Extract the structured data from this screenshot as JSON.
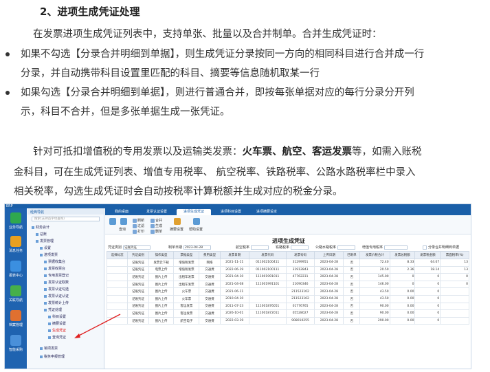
{
  "doc": {
    "heading": "2、进项生成凭证处理",
    "intro": "在发票进项生成凭证列表中，支持单张、批量以及合并制单。合并生成凭证时：",
    "bullet1_line1": "如果不勾选【分录合并明细到单据】，则生成凭证分录按同一方向的相同科目进行合并成一行",
    "bullet1_line2": "分录，并自动携带科目设置里匹配的科目、摘要等信息随机取某一行",
    "bullet2_line1": "如果勾选【分录合并明细到单据】，则进行普通合并，即按每张单据对应的每行分录分开列",
    "bullet2_line2": "示，科目不合并，但是多张单据生成一张凭证。",
    "p2_pre": "针对可抵扣增值税的专用发票以及运输类发票：",
    "p2_bold": "火车票、航空、客运发票",
    "p2_post": "等，如需入账税",
    "p2_line2": "金科目，可在生成凭证列表、增值专用税率、 航空税率、铁路税率、公路水路税率栏中录入",
    "p2_line3": "相关税率，勾选生成凭证时会自动按税率计算税额并生成对应的税金分录。"
  },
  "app": {
    "title": "ERP",
    "nav": [
      {
        "label": "业务导航",
        "color": "#2fa84f"
      },
      {
        "label": "消息任务",
        "color": "#e8a020"
      },
      {
        "label": "报表中心",
        "color": "#3b8fe0"
      },
      {
        "label": "关联导航",
        "color": "#46b04a"
      },
      {
        "label": "档案管理",
        "color": "#e07030"
      },
      {
        "label": "智能采购",
        "color": "#4a90d9"
      }
    ],
    "tree_title": "经典导航",
    "tree_search": "搜索(支持首字母查询)",
    "tree_items": [
      "财务会计",
      "总账",
      "发票管理",
      "设置",
      "进项发票",
      "票据收集台",
      "发票收票台",
      "专用发票登记",
      "发票认证取数",
      "发票认证勾选",
      "发票认证认证",
      "发票统计上传",
      "凭证处理",
      "科目设置",
      "摘要设置",
      "生成凭证",
      "查询凭证",
      "销项发票",
      "税务申报管理"
    ],
    "tabs": [
      "我的桌面",
      "发票认证设置",
      "进项生成凭证",
      "进项科目设置",
      "进项摘要设定"
    ],
    "toolbar": {
      "query": "查询",
      "refresh": "刷新",
      "filter": "过滤",
      "merge": "合并",
      "generate": "生成",
      "print": "打印",
      "delete": "删单",
      "settings": "摘要设置",
      "help": "帮助设置"
    },
    "page_title": "进项生成凭证",
    "filters": {
      "voucher_type_label": "凭证类别",
      "voucher_type_value": "记账凭证",
      "date_label": "制单日期",
      "date_value": "2023-04-28",
      "air_label": "航空税率",
      "rail_label": "铁路税率",
      "road_label": "公路水路税率",
      "vat_label": "增值专用税率",
      "merge_label": "分录合并明细到单据"
    },
    "columns": [
      "选择标志",
      "凭证类别",
      "操作类型",
      "票据类型",
      "费用类型",
      "发票日期",
      "发票代码",
      "发票号码",
      "上传日期",
      "已制单",
      "发票价税合计",
      "发票总税额",
      "发票税金额",
      "票面税率(%)"
    ],
    "rows": [
      [
        "",
        "记账凭证",
        "发票云下载",
        "增值税发票",
        "网络",
        "2021-11-11",
        "011002100411",
        "31299951",
        "2023-04-28",
        "否",
        "72.40",
        "8.33",
        "64.07",
        "13"
      ],
      [
        "",
        "记账凭证",
        "电票上传",
        "增值税发票",
        "交通费",
        "2022-06-19",
        "011002100111",
        "31912843",
        "2023-04-28",
        "否",
        "20.50",
        "2.36",
        "18.14",
        "13"
      ],
      [
        "",
        "记账凭证",
        "图片上传",
        "出租车发票",
        "交通费",
        "2021-04-10",
        "111001991011",
        "47762231",
        "2023-04-28",
        "否",
        "145.00",
        "0",
        "0",
        "0"
      ],
      [
        "",
        "记账凭证",
        "图片上传",
        "出租车发票",
        "交通费",
        "2021-04-08",
        "111001991101",
        "21090346",
        "2023-04-28",
        "否",
        "146.00",
        "0",
        "0",
        "0"
      ],
      [
        "",
        "记账凭证",
        "图片上传",
        "火车票",
        "交通费",
        "2021-06-11",
        "",
        "211523102",
        "2023-04-28",
        "否",
        "43.50",
        "0.00",
        "0",
        ""
      ],
      [
        "",
        "记账凭证",
        "图片上传",
        "火车票",
        "交通费",
        "2010-04-10",
        "",
        "211523102",
        "2023-04-28",
        "否",
        "43.50",
        "0.00",
        "0",
        ""
      ],
      [
        "",
        "记账凭证",
        "图片上传",
        "客运发票",
        "交通费",
        "2011-07-23",
        "111001876051",
        "01776765",
        "2023-04-28",
        "否",
        "90.00",
        "0.00",
        "0",
        ""
      ],
      [
        "",
        "记账凭证",
        "图片上传",
        "客运发票",
        "交通费",
        "2026-10-01",
        "111001872011",
        "05528027",
        "2023-04-28",
        "否",
        "90.00",
        "0.00",
        "0",
        ""
      ],
      [
        "",
        "记账凭证",
        "图片上传",
        "航空电子",
        "交通费",
        "2022-03-19",
        "",
        "908010255",
        "2023-04-28",
        "否",
        "290.00",
        "0.00",
        "0",
        ""
      ]
    ],
    "colors": {
      "brand": "#1a5fa8",
      "arrow": "#e02020"
    }
  }
}
